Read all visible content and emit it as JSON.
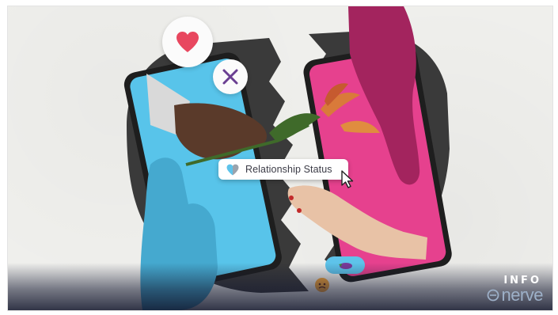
{
  "status_card": {
    "label": "Relationship Status"
  },
  "badges": {
    "like": "heart-icon",
    "dislike": "x-icon"
  },
  "overlay": {
    "info_label": "INFO",
    "brand": "nerve"
  },
  "colors": {
    "heart": "#e8475f",
    "x_mark": "#6a3f92",
    "left_phone_screen": "#58c4ea",
    "right_phone_screen": "#e6418e",
    "blue_hand": "#45a9cf",
    "magenta_hand": "#a3245e",
    "torn_paper": "#3a3a3a"
  }
}
